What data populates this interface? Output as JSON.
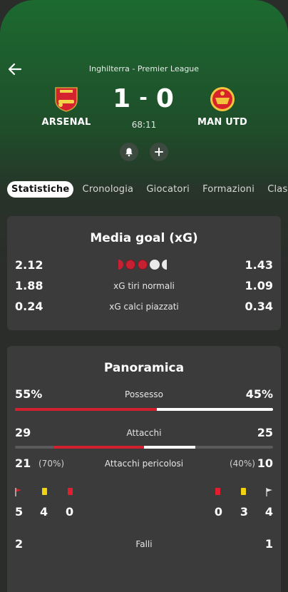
{
  "header": {
    "league": "Inghilterra - Premier League",
    "home_team": "ARSENAL",
    "away_team": "MAN UTD",
    "home_score": "1",
    "separator": "-",
    "away_score": "0",
    "clock": "68:11"
  },
  "tabs": [
    "Statistiche",
    "Cronologia",
    "Giocatori",
    "Formazioni",
    "Class"
  ],
  "xg": {
    "title": "Media goal (xG)",
    "rows": [
      {
        "home": "2.12",
        "label": "",
        "away": "1.43"
      },
      {
        "home": "1.88",
        "label": "xG tiri normali",
        "away": "1.09"
      },
      {
        "home": "0.24",
        "label": "xG calci piazzati",
        "away": "0.34"
      }
    ]
  },
  "overview": {
    "title": "Panoramica",
    "possession": {
      "home": "55%",
      "label": "Possesso",
      "away": "45%",
      "home_fraction": 0.55
    },
    "attacks": {
      "home": "29",
      "label": "Attacchi",
      "away": "25"
    },
    "dangerous": {
      "home": "21",
      "home_pct": "(70%)",
      "label": "Attacchi pericolosi",
      "away_pct": "(40%)",
      "away": "10"
    },
    "discipline": {
      "home_corners": "5",
      "home_yellow": "4",
      "home_red": "0",
      "away_red": "0",
      "away_yellow": "3",
      "away_corners": "4"
    },
    "fouls": {
      "home": "2",
      "label": "Falli",
      "away": "1"
    }
  },
  "colors": {
    "home": "#d2202f",
    "away": "#ffffff",
    "yellow_card": "#f1d40f",
    "red_card": "#e0202e"
  }
}
